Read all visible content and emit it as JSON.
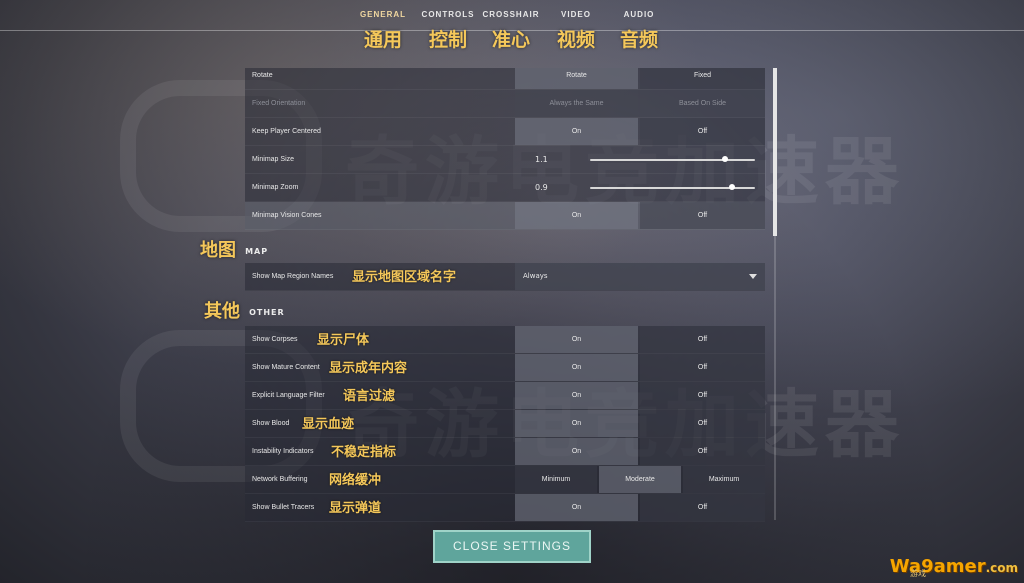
{
  "tabs": [
    {
      "en": "GENERAL",
      "zh": "通用",
      "active": true
    },
    {
      "en": "CONTROLS",
      "zh": "控制",
      "active": false
    },
    {
      "en": "CROSSHAIR",
      "zh": "准心",
      "active": false
    },
    {
      "en": "VIDEO",
      "zh": "视频",
      "active": false
    },
    {
      "en": "AUDIO",
      "zh": "音频",
      "active": false
    }
  ],
  "minimap_rows": [
    {
      "label": "Rotate",
      "options": [
        "Rotate",
        "Fixed"
      ],
      "selected": 0,
      "disabled": false
    },
    {
      "label": "Fixed Orientation",
      "options": [
        "Always the Same",
        "Based On Side"
      ],
      "selected": 0,
      "disabled": true
    },
    {
      "label": "Keep Player Centered",
      "options": [
        "On",
        "Off"
      ],
      "selected": 0,
      "disabled": false
    }
  ],
  "sliders": [
    {
      "label": "Minimap Size",
      "value": "1.1",
      "fraction": 0.82
    },
    {
      "label": "Minimap Zoom",
      "value": "0.9",
      "fraction": 0.86
    }
  ],
  "vision_cones": {
    "label": "Minimap Vision Cones",
    "options": [
      "On",
      "Off"
    ],
    "selected": 0
  },
  "map_section": {
    "zh": "地图",
    "en": "MAP"
  },
  "map_region": {
    "label": "Show Map Region Names",
    "zh": "显示地图区域名字",
    "value": "Always"
  },
  "other_section": {
    "zh": "其他",
    "en": "OTHER"
  },
  "other_rows": [
    {
      "label": "Show Corpses",
      "zh": "显示尸体",
      "options": [
        "On",
        "Off"
      ],
      "selected": 0
    },
    {
      "label": "Show Mature Content",
      "zh": "显示成年内容",
      "options": [
        "On",
        "Off"
      ],
      "selected": 0
    },
    {
      "label": "Explicit Language Filter",
      "zh": "语言过滤",
      "options": [
        "On",
        "Off"
      ],
      "selected": 0
    },
    {
      "label": "Show Blood",
      "zh": "显示血迹",
      "options": [
        "On",
        "Off"
      ],
      "selected": 0
    },
    {
      "label": "Instability Indicators",
      "zh": "不稳定指标",
      "options": [
        "On",
        "Off"
      ],
      "selected": 0
    },
    {
      "label": "Network Buffering",
      "zh": "网络缓冲",
      "options": [
        "Minimum",
        "Moderate",
        "Maximum"
      ],
      "selected": 1
    },
    {
      "label": "Show Bullet Tracers",
      "zh": "显示弹道",
      "options": [
        "On",
        "Off"
      ],
      "selected": 0
    }
  ],
  "close_button": "CLOSE SETTINGS",
  "watermark_text": "奇游电竞加速器",
  "logo": {
    "text": "Wa9amer",
    "dotcom": ".com",
    "sub": "游戏"
  },
  "colors": {
    "accent_gold": "#f5c85a",
    "close_button": "#5fa59c"
  }
}
